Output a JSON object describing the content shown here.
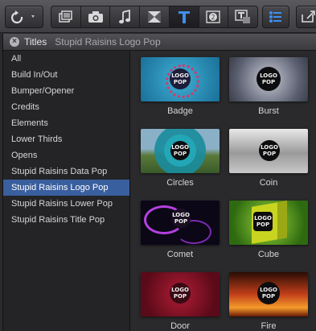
{
  "toolbar": {
    "left_button_icon": "refresh-menu-icon",
    "segment_icons": [
      "photos-icon",
      "camera-icon",
      "music-icon",
      "transitions-icon",
      "titles-icon",
      "generators-icon",
      "themes-icon"
    ],
    "active_segment": "titles-icon",
    "right_icons": [
      "inspector-icon",
      "share-icon"
    ]
  },
  "browser": {
    "title": "Titles",
    "path": "Stupid Raisins Logo Pop"
  },
  "sidebar": {
    "items": [
      {
        "label": "All"
      },
      {
        "label": "Build In/Out"
      },
      {
        "label": "Bumper/Opener"
      },
      {
        "label": "Credits"
      },
      {
        "label": "Elements"
      },
      {
        "label": "Lower Thirds"
      },
      {
        "label": "Opens"
      },
      {
        "label": "Stupid Raisins Data Pop"
      },
      {
        "label": "Stupid Raisins Logo Pop"
      },
      {
        "label": "Stupid Raisins Lower Pop"
      },
      {
        "label": "Stupid Raisins Title Pop"
      }
    ],
    "selected": "Stupid Raisins Logo Pop"
  },
  "tiles": [
    {
      "label": "Badge",
      "logo_text": "LOGO POP"
    },
    {
      "label": "Burst",
      "logo_text": "LOGO POP"
    },
    {
      "label": "Circles",
      "logo_text": "LOGO POP"
    },
    {
      "label": "Coin",
      "logo_text": "LOGO POP"
    },
    {
      "label": "Comet",
      "logo_text": "LOGO POP"
    },
    {
      "label": "Cube",
      "logo_text": "LOGO POP"
    },
    {
      "label": "Door",
      "logo_text": "LOGO POP"
    },
    {
      "label": "Fire",
      "logo_text": "LOGO POP"
    }
  ]
}
